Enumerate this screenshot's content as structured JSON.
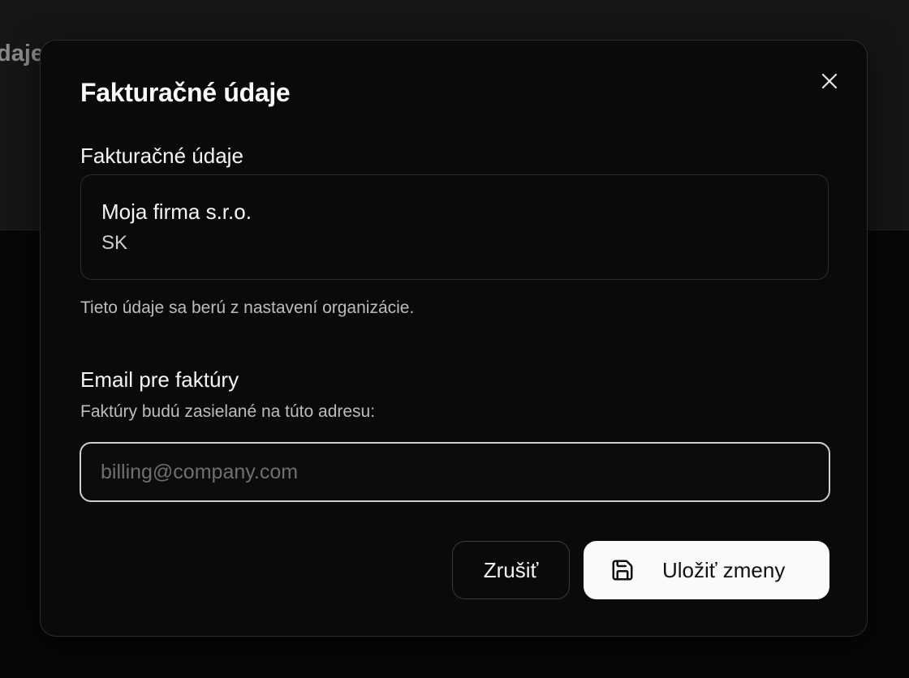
{
  "background": {
    "page_title_fragment": "daje"
  },
  "modal": {
    "title": "Fakturačné údaje",
    "close_icon": "close-icon",
    "billing": {
      "label": "Fakturačné údaje",
      "company_name": "Moja firma s.r.o.",
      "country": "SK",
      "helper": "Tieto údaje sa berú z nastavení organizácie."
    },
    "email": {
      "label": "Email pre faktúry",
      "helper": "Faktúry budú zasielané na túto adresu:",
      "value": "",
      "placeholder": "billing@company.com"
    },
    "actions": {
      "cancel_label": "Zrušiť",
      "save_label": "Uložiť zmeny",
      "save_icon": "save-icon"
    }
  }
}
